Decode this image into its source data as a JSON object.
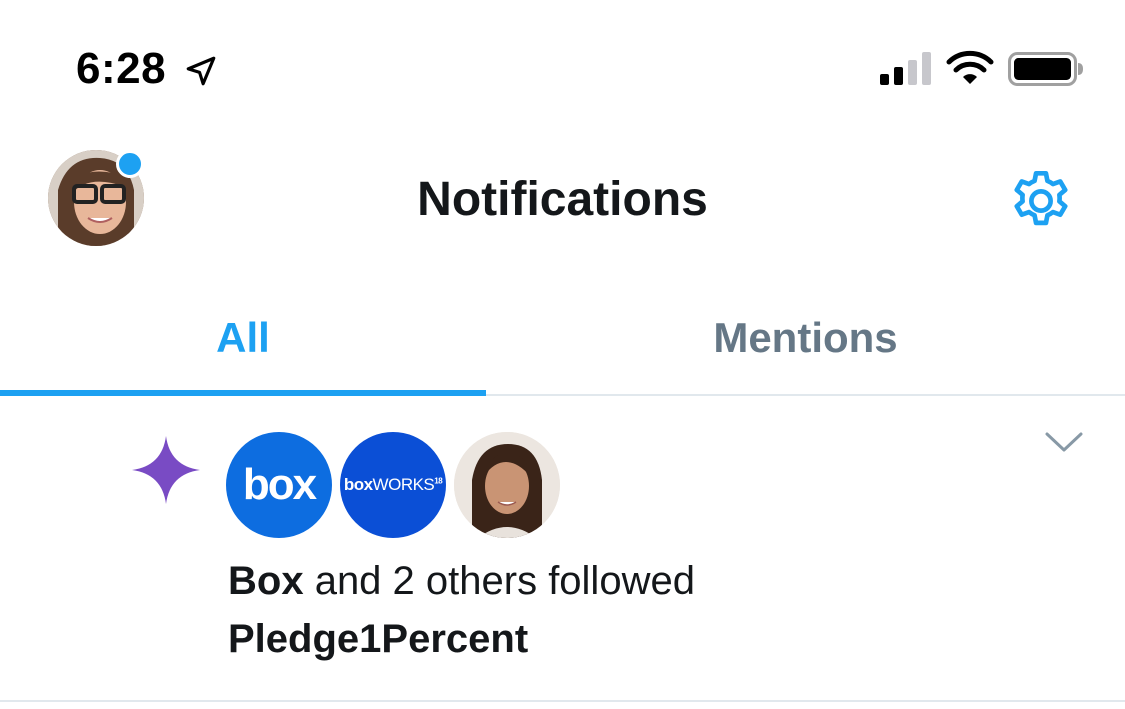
{
  "status_bar": {
    "time": "6:28",
    "icons": [
      "location-arrow-icon",
      "cellular-signal-icon",
      "wifi-icon",
      "battery-icon"
    ]
  },
  "header": {
    "title": "Notifications",
    "avatar_icon": "profile-avatar",
    "settings_icon": "gear-icon"
  },
  "tabs": [
    {
      "label": "All",
      "active": true
    },
    {
      "label": "Mentions",
      "active": false
    }
  ],
  "notification": {
    "icon": "sparkle-icon",
    "avatars": [
      {
        "name": "box",
        "text": "box"
      },
      {
        "name": "boxworks",
        "text_box": "box",
        "text_works": "WORKS",
        "text_sup": "18"
      },
      {
        "name": "person"
      }
    ],
    "actor": "Box",
    "action": " and 2 others followed",
    "target": "Pledge1Percent"
  },
  "colors": {
    "accent": "#1da1f2",
    "sparkle": "#794bc4",
    "muted": "#657786",
    "divider": "#e1e8ed",
    "box_blue": "#0d6de0",
    "boxworks_blue": "#0b4fd6"
  }
}
